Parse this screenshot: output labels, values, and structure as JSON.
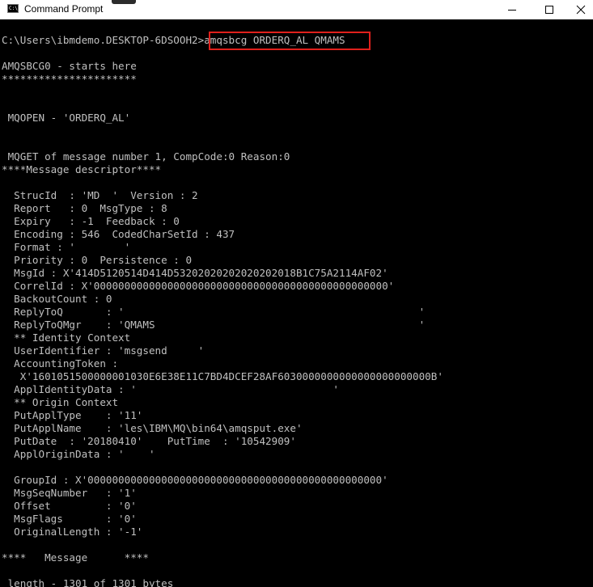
{
  "window": {
    "title": "Command Prompt",
    "app_icon_text": "C:\\",
    "controls": {
      "minimize": "minimize",
      "maximize": "maximize",
      "close": "close"
    }
  },
  "console": {
    "lines": [
      "C:\\Users\\ibmdemo.DESKTOP-6DSOOH2>amqsbcg ORDERQ_AL QMAMS",
      "",
      "AMQSBCG0 - starts here",
      "**********************",
      "",
      "",
      " MQOPEN - 'ORDERQ_AL'",
      "",
      "",
      " MQGET of message number 1, CompCode:0 Reason:0",
      "****Message descriptor****",
      "",
      "  StrucId  : 'MD  '  Version : 2",
      "  Report   : 0  MsgType : 8",
      "  Expiry   : -1  Feedback : 0",
      "  Encoding : 546  CodedCharSetId : 437",
      "  Format : '        '",
      "  Priority : 0  Persistence : 0",
      "  MsgId : X'414D5120514D414D53202020202020202018B1C75A2114AF02'",
      "  CorrelId : X'000000000000000000000000000000000000000000000000'",
      "  BackoutCount : 0",
      "  ReplyToQ       : '                                                '",
      "  ReplyToQMgr    : 'QMAMS                                           '",
      "  ** Identity Context",
      "  UserIdentifier : 'msgsend     '",
      "  AccountingToken :",
      "   X'1601051500000001030E6E38E11C7BD4DCEF28AF6030000000000000000000000B'",
      "  ApplIdentityData : '                                '",
      "  ** Origin Context",
      "  PutApplType    : '11'",
      "  PutApplName    : 'les\\IBM\\MQ\\bin64\\amqsput.exe'",
      "  PutDate  : '20180410'    PutTime  : '10542909'",
      "  ApplOriginData : '    '",
      "",
      "  GroupId : X'000000000000000000000000000000000000000000000000'",
      "  MsgSeqNumber   : '1'",
      "  Offset         : '0'",
      "  MsgFlags       : '0'",
      "  OriginalLength : '-1'",
      "",
      "****   Message      ****",
      "",
      " length - 1301 of 1301 bytes"
    ]
  },
  "highlight": {
    "target": "amqsbcg ORDERQ_AL QMAMS",
    "color": "#e0201c"
  },
  "colors": {
    "console_bg": "#000000",
    "console_fg": "#c0c0c0",
    "titlebar_bg": "#ffffff"
  }
}
